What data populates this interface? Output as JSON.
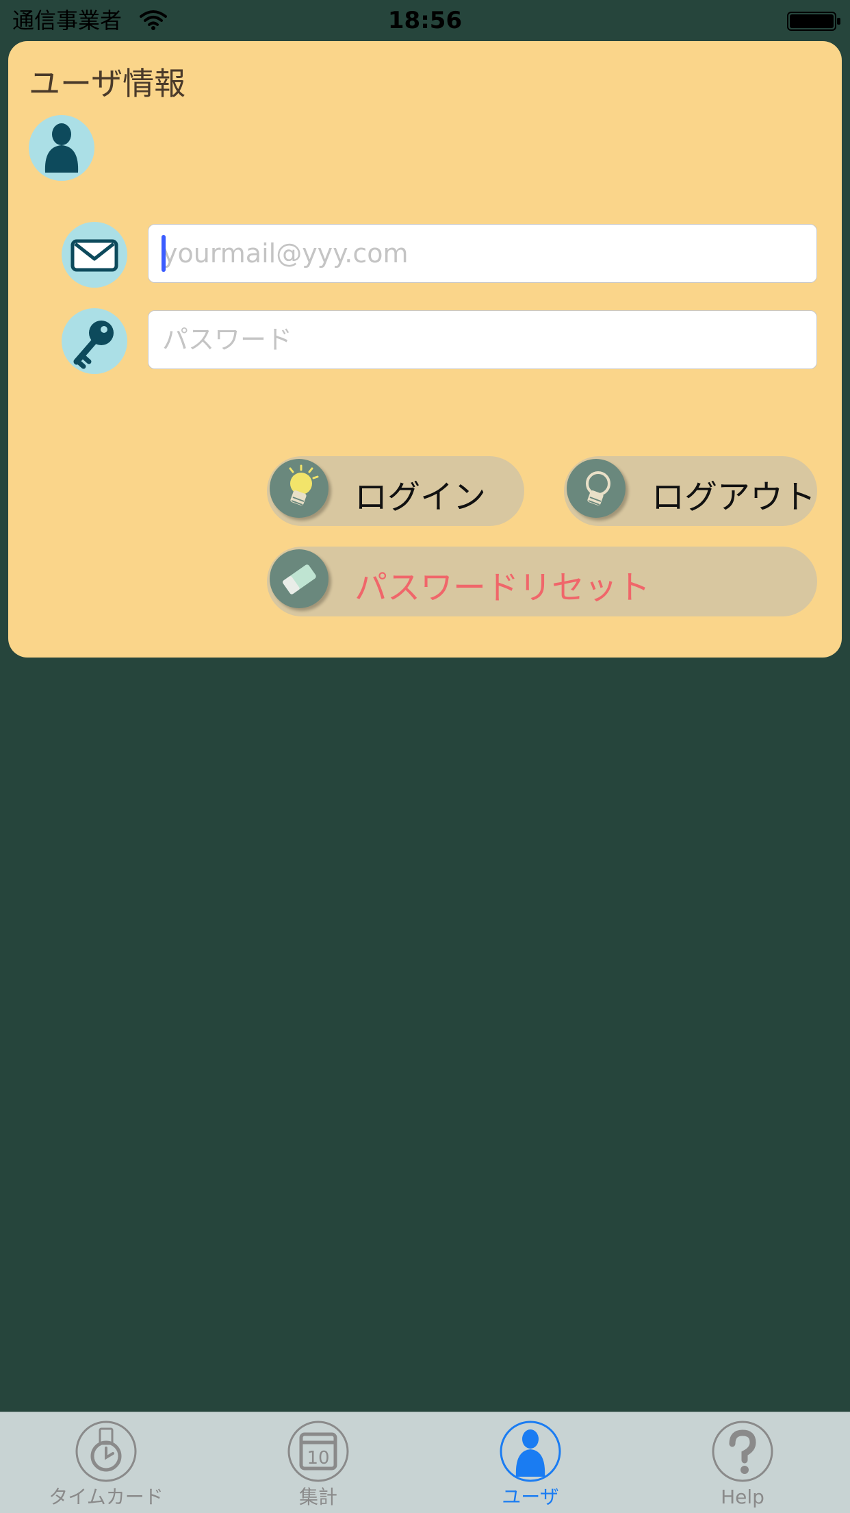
{
  "status_bar": {
    "carrier": "通信事業者",
    "time": "18:56"
  },
  "card": {
    "title": "ユーザ情報",
    "email": {
      "value": "",
      "placeholder": "yourmail@yyy.com"
    },
    "password": {
      "value": "",
      "placeholder": "パスワード"
    },
    "buttons": {
      "login": "ログイン",
      "logout": "ログアウト",
      "reset": "パスワードリセット"
    }
  },
  "tab_bar": {
    "items": [
      {
        "label": "タイムカード",
        "icon": "timecard-icon"
      },
      {
        "label": "集計",
        "icon": "calendar-icon",
        "calendar_day": "10"
      },
      {
        "label": "ユーザ",
        "icon": "user-icon",
        "active": true
      },
      {
        "label": "Help",
        "icon": "help-icon"
      }
    ]
  },
  "colors": {
    "background": "#26453c",
    "card": "#fad58a",
    "icon_circle": "#abdfe6",
    "button": "#d8c7a0",
    "reset_text": "#f0666a",
    "tab_active": "#1a7cf2"
  }
}
